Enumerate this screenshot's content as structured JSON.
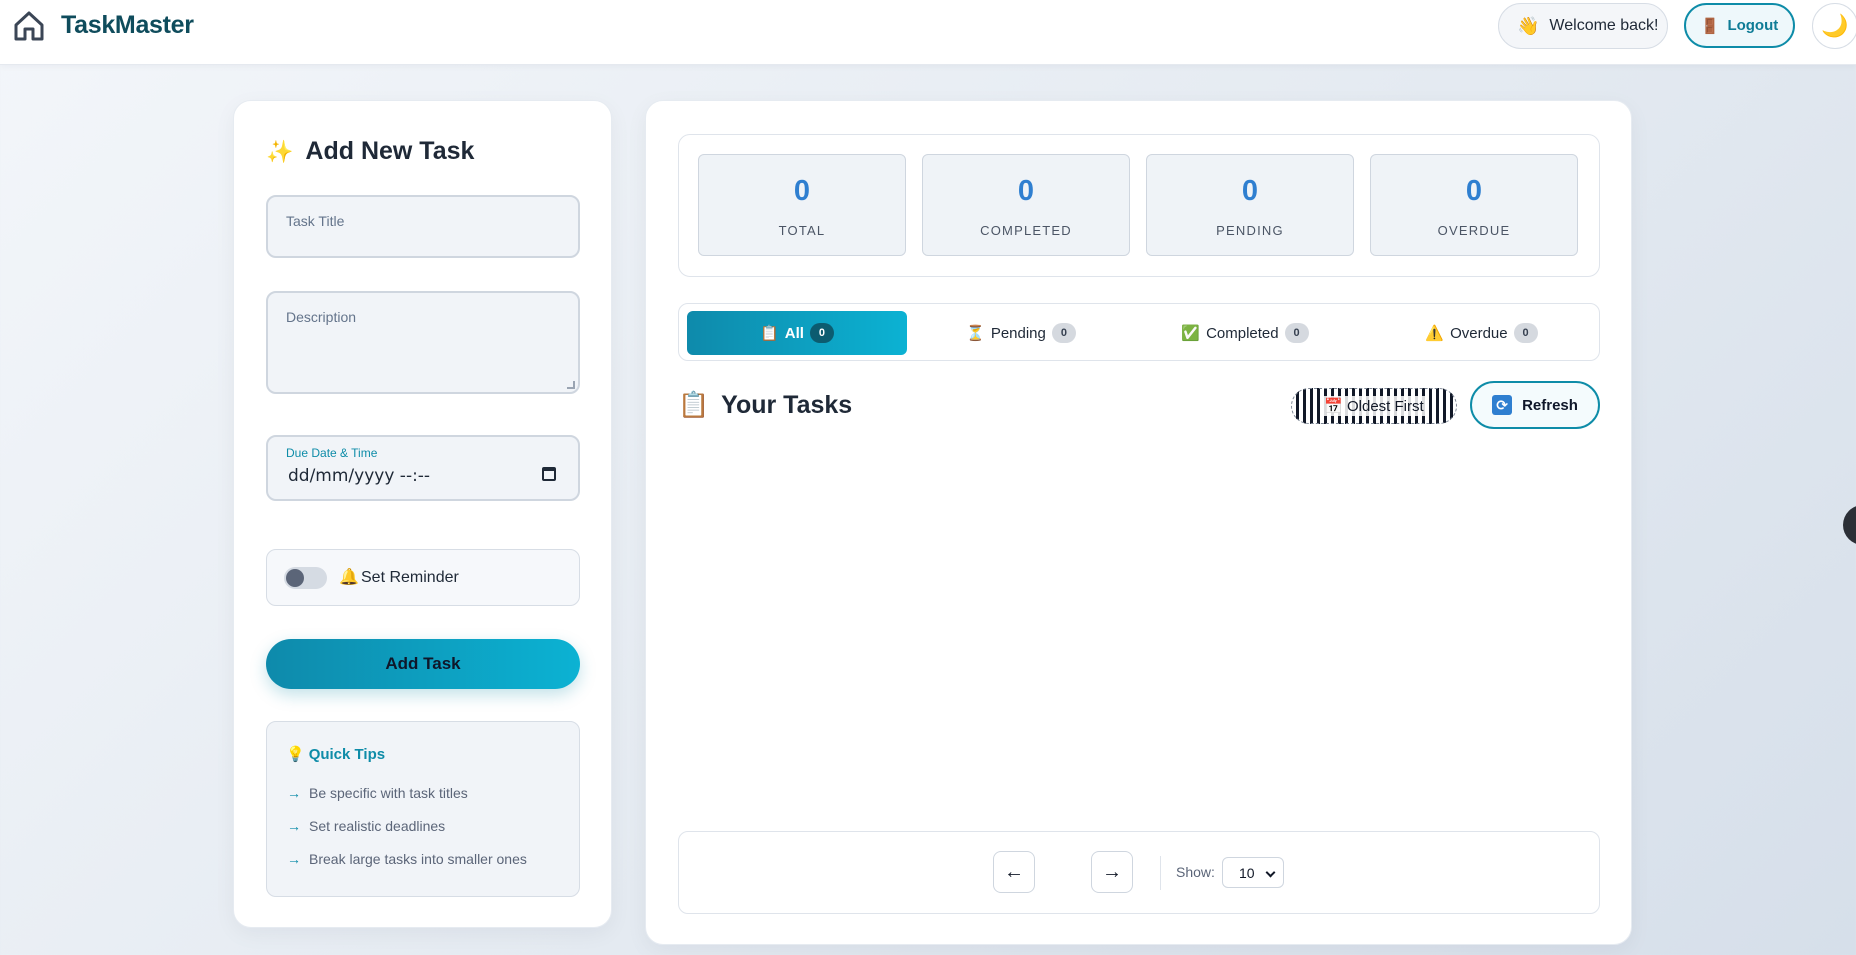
{
  "header": {
    "brand": "TaskMaster",
    "welcome_emoji": "👋",
    "welcome_text": "Welcome back!",
    "logout_emoji": "🚪",
    "logout_label": "Logout",
    "theme_emoji": "🌙"
  },
  "add_task": {
    "title_emoji": "✨",
    "title": "Add New Task",
    "task_title_placeholder": "Task Title",
    "description_placeholder": "Description",
    "due_label": "Due Date & Time",
    "due_value": "dd/mm/yyyy --:--",
    "reminder_emoji": "🔔",
    "reminder_label": "Set Reminder",
    "reminder_on": false,
    "submit_label": "Add Task"
  },
  "tips": {
    "emoji": "💡",
    "title": "Quick Tips",
    "items": [
      "Be specific with task titles",
      "Set realistic deadlines",
      "Break large tasks into smaller ones"
    ]
  },
  "stats": [
    {
      "value": "0",
      "label": "TOTAL"
    },
    {
      "value": "0",
      "label": "COMPLETED"
    },
    {
      "value": "0",
      "label": "PENDING"
    },
    {
      "value": "0",
      "label": "OVERDUE"
    }
  ],
  "filters": [
    {
      "emoji": "📋",
      "label": "All",
      "count": "0",
      "active": true
    },
    {
      "emoji": "⏳",
      "label": "Pending",
      "count": "0",
      "active": false
    },
    {
      "emoji": "✅",
      "label": "Completed",
      "count": "0",
      "active": false
    },
    {
      "emoji": "⚠️",
      "label": "Overdue",
      "count": "0",
      "active": false
    }
  ],
  "tasks": {
    "emoji": "📋",
    "heading": "Your Tasks",
    "sort_emoji": "📅",
    "sort_label": "Oldest First",
    "refresh_emoji": "🔄",
    "refresh_label": "Refresh"
  },
  "pagination": {
    "prev": "←",
    "next": "→",
    "show_label": "Show:",
    "page_size": "10"
  },
  "colors": {
    "accent": "#0e8ca8",
    "stat_number": "#2f7fd0"
  }
}
